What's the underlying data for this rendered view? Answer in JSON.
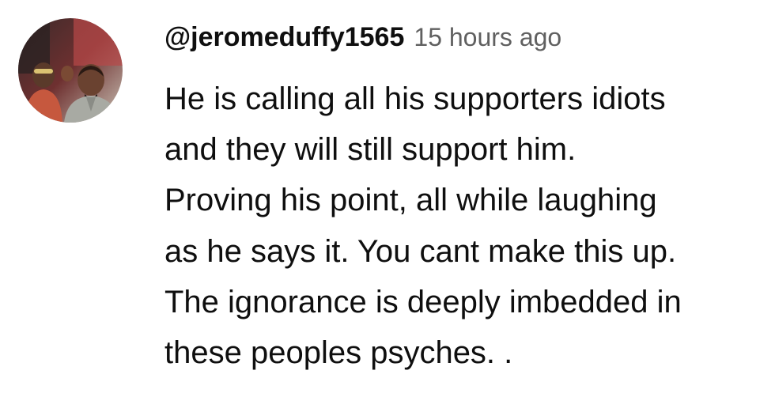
{
  "comment": {
    "author_handle": "@jeromeduffy1565",
    "timestamp": "15 hours ago",
    "avatar": "avatar-photo-two-people",
    "lines": [
      "He is calling all his supporters idiots",
      "and they will still support him.",
      "Proving his point, all while laughing",
      "as he says it. You cant make this up.",
      "The ignorance is deeply imbedded in",
      "these peoples psyches. ."
    ]
  },
  "colors": {
    "text_primary": "#0f0f0f",
    "text_secondary": "#606060",
    "background": "#ffffff"
  }
}
